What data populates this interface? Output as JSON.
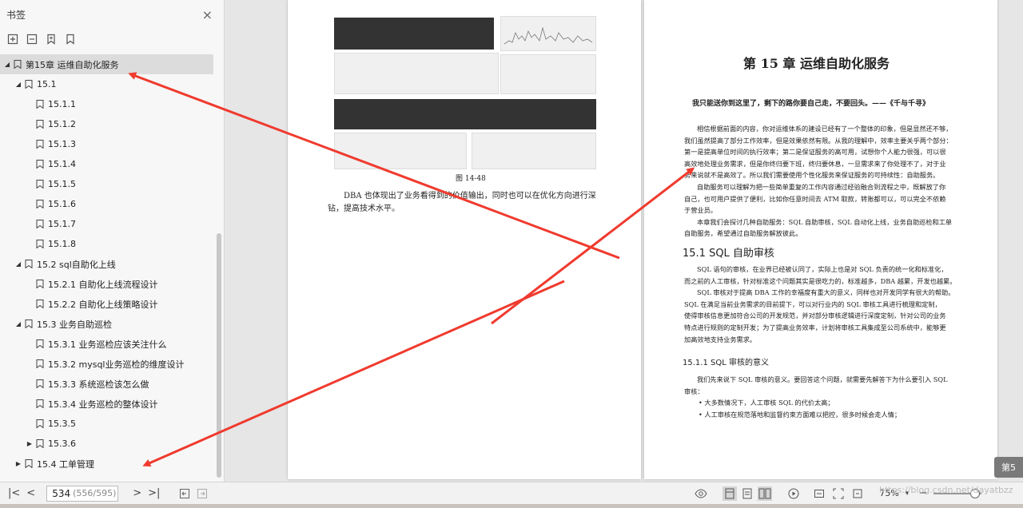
{
  "sidebar": {
    "title": "书签",
    "close_icon": "×",
    "items": [
      {
        "label": "第15章  运维自助化服务",
        "level": 0,
        "expanded": true,
        "selected": true
      },
      {
        "label": "15.1",
        "level": 1,
        "expanded": true
      },
      {
        "label": "15.1.1",
        "level": 2
      },
      {
        "label": "15.1.2",
        "level": 2
      },
      {
        "label": "15.1.3",
        "level": 2
      },
      {
        "label": "15.1.4",
        "level": 2
      },
      {
        "label": "15.1.5",
        "level": 2
      },
      {
        "label": "15.1.6",
        "level": 2
      },
      {
        "label": "15.1.7",
        "level": 2
      },
      {
        "label": "15.1.8",
        "level": 2
      },
      {
        "label": "15.2 sql自助化上线",
        "level": 1,
        "expanded": true
      },
      {
        "label": "15.2.1 自助化上线流程设计",
        "level": 2
      },
      {
        "label": "15.2.2 自助化上线策略设计",
        "level": 2
      },
      {
        "label": "15.3 业务自助巡检",
        "level": 1,
        "expanded": true
      },
      {
        "label": "15.3.1 业务巡检应该关注什么",
        "level": 2
      },
      {
        "label": "15.3.2 mysql业务巡检的维度设计",
        "level": 2
      },
      {
        "label": "15.3.3 系统巡检该怎么做",
        "level": 2
      },
      {
        "label": "15.3.4 业务巡检的整体设计",
        "level": 2
      },
      {
        "label": "15.3.5",
        "level": 2
      },
      {
        "label": "15.3.6",
        "level": 2,
        "collapsed": true
      },
      {
        "label": "15.4 工单管理",
        "level": 1,
        "collapsed": true
      }
    ]
  },
  "left_page": {
    "figure_caption": "图 14-48",
    "para": "DBA 也体现出了业务看得到的价值输出，同时也可以在优化方向进行深钻，提高技术水平。"
  },
  "right_page": {
    "chapter_title": "第 15 章    运维自助化服务",
    "epigraph": "我只能送你到这里了，剩下的路你要自己走，不要回头。——《千与千寻》",
    "intro": [
      "相信根据前面的内容，你对运维体系的建设已经有了一个整体的印象，但是显然还不够，",
      "我们虽然提高了部分工作效率，但是效果依然有限。从我的理解中，效率主要关乎两个部分：",
      "第一是提高单位时间的执行效率；第二是保证服务的高可用，试想你个人能力很强，可以很",
      "高效地处理业务需求，但是你终归要下班，终归要休息，一旦需求来了你处理不了，对于业",
      "务来说就不是高效了。所以我们需要使用个性化服务来保证服务的可持续性：自助服务。",
      "自助服务可以理解为把一些简单重复的工作内容通过经验融合到流程之中，既解放了你",
      "自己，也可用户提供了便利，比如你任意时间去 ATM 取款，转账都可以，可以完全不依赖",
      "于营业员。",
      "本章我们会探讨几种自助服务：SQL 自助审核，SQL 自动化上线，业务自助巡检和工单",
      "自助服务，希望通过自助服务解放彼此。"
    ],
    "section_title": "15.1   SQL 自助审核",
    "section_body": [
      "SQL 语句的审核，在业界已经被认同了，实际上也是对 SQL 负责的统一化和标准化，",
      "而之前的人工审核，针对标准这个问题其实是很吃力的，标准越多，DBA 越累，开发也越累。",
      "SQL 审核对于提高 DBA 工作的幸福度有重大的意义，同样也对开发同学有很大的帮助。",
      "SQL 在满足当前业务需求的目前提下，可以对行业内的 SQL 审核工具进行梳理和定制，",
      "使得审核信息更加符合公司的开发规范，并对部分审核逻辑进行深度定制，针对公司的业务",
      "特点进行规则的定制开发；为了提高业务效率，计划将审核工具集成至公司系统中，能够更",
      "加高效地支持业务需求。"
    ],
    "subsection_title": "15.1.1   SQL 审核的意义",
    "subsection_body": [
      "我们先来说下 SQL 审核的意义。要回答这个问题，就需要先解答下为什么要引入 SQL",
      "审核："
    ],
    "bullets": [
      "大多数情况下，人工审核 SQL 的代价太高；",
      "人工审核在规范落地和监督约束方面难以把控，很多时候会走人情；"
    ]
  },
  "toolbar": {
    "page_current": "534",
    "page_total": "(556/595)",
    "zoom": "75%",
    "watermark": "https://blog.csdn.net/dayatbzz",
    "side_tab": "第5"
  },
  "colors": {
    "arrow": "#f03a2e",
    "selected_row": "#dcdcdc"
  }
}
